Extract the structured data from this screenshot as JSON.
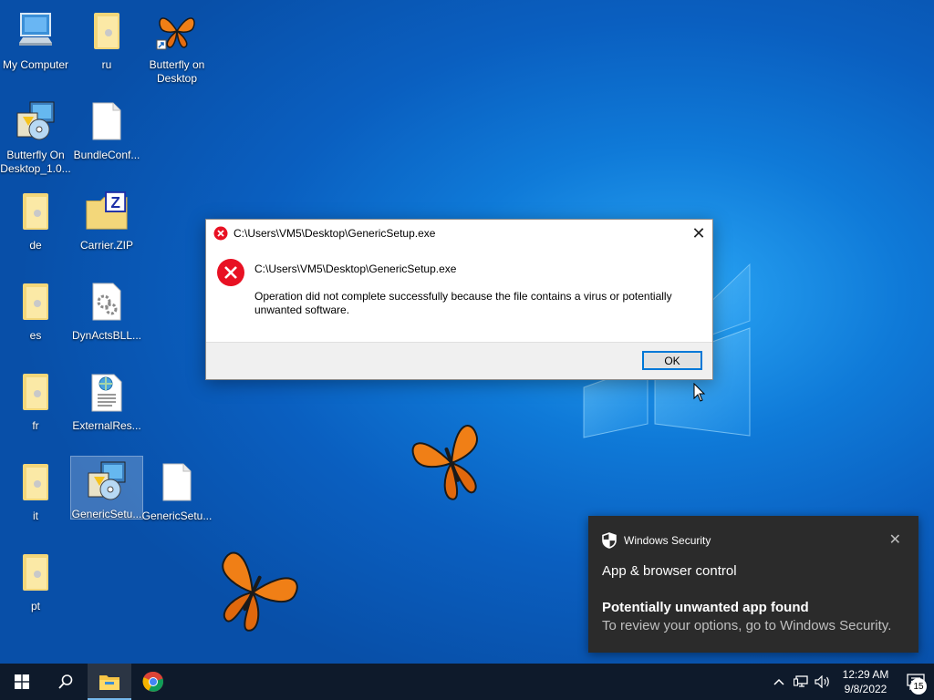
{
  "desktop": {
    "icons": [
      {
        "label": "My Computer",
        "icon": "computer-icon"
      },
      {
        "label": "ru",
        "icon": "folder-icon"
      },
      {
        "label": "Butterfly on Desktop",
        "icon": "butterfly-shortcut-icon"
      },
      {
        "label": "Butterfly On Desktop_1.0...",
        "icon": "installer-icon"
      },
      {
        "label": "BundleConf...",
        "icon": "file-icon"
      },
      {
        "label": "de",
        "icon": "folder-icon"
      },
      {
        "label": "Carrier.ZIP",
        "icon": "zip-icon"
      },
      {
        "label": "es",
        "icon": "folder-icon"
      },
      {
        "label": "DynActsBLL...",
        "icon": "dll-icon"
      },
      {
        "label": "fr",
        "icon": "folder-icon"
      },
      {
        "label": "ExternalRes...",
        "icon": "xml-icon"
      },
      {
        "label": "it",
        "icon": "folder-icon"
      },
      {
        "label": "GenericSetu...",
        "icon": "installer-icon"
      },
      {
        "label": "GenericSetu...",
        "icon": "file-icon"
      },
      {
        "label": "pt",
        "icon": "folder-icon"
      }
    ]
  },
  "dialog": {
    "title": "C:\\Users\\VM5\\Desktop\\GenericSetup.exe",
    "path": "C:\\Users\\VM5\\Desktop\\GenericSetup.exe",
    "message": "Operation did not complete successfully because the file contains a virus or potentially unwanted software.",
    "ok_label": "OK",
    "close_symbol": "✕"
  },
  "toast": {
    "app_name": "Windows Security",
    "title": "App & browser control",
    "headline": "Potentially unwanted app found",
    "body": "To review your options, go to Windows Security.",
    "close_symbol": "✕"
  },
  "taskbar": {
    "time": "12:29 AM",
    "date": "9/8/2022",
    "notification_count": "15"
  },
  "colors": {
    "error_red": "#e81123",
    "accent": "#0078d7",
    "taskbar": "#0e1a2b",
    "toast_bg": "#2b2b2b"
  }
}
